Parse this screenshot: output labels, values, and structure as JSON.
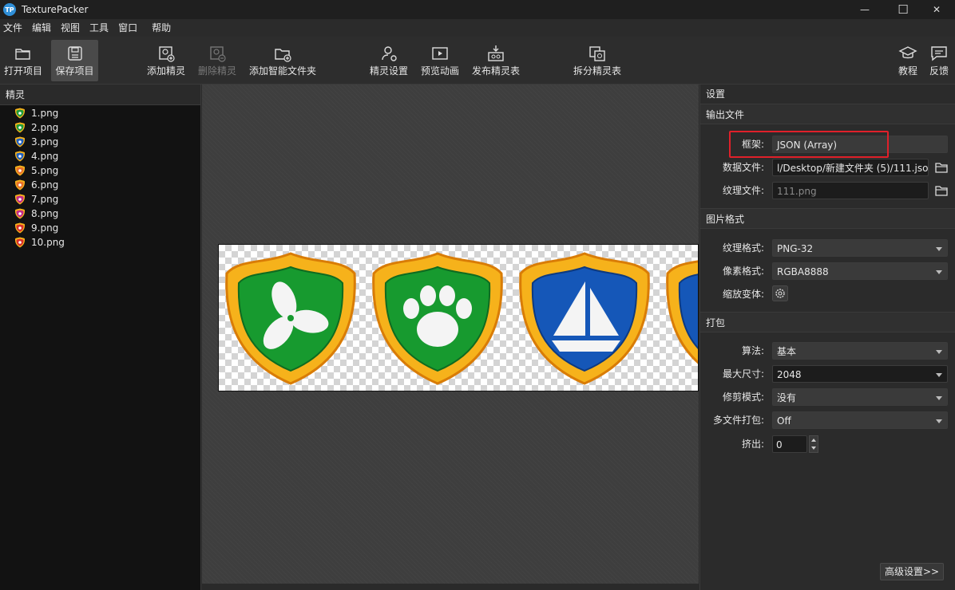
{
  "app": {
    "logo": "TP",
    "title": "TexturePacker"
  },
  "window_controls": [
    {
      "icon": "minimize-icon",
      "glyph": "—"
    },
    {
      "icon": "maximize-icon",
      "glyph": "☐"
    },
    {
      "icon": "close-icon",
      "glyph": "✕"
    }
  ],
  "menu": [
    "文件",
    "编辑",
    "视图",
    "工具",
    "窗口",
    "帮助"
  ],
  "toolbar": {
    "open_project": "打开项目",
    "save_project": "保存项目",
    "add_sprite": "添加精灵",
    "delete_sprite": "删除精灵",
    "add_smart_folder": "添加智能文件夹",
    "sprite_settings": "精灵设置",
    "preview_animation": "预览动画",
    "publish_sheet": "发布精灵表",
    "split_sheet": "拆分精灵表",
    "tutorial": "教程",
    "feedback": "反馈"
  },
  "sprites_panel": {
    "title": "精灵",
    "items": [
      {
        "name": "1.png",
        "color": "#1e9b3a"
      },
      {
        "name": "2.png",
        "color": "#1e9b3a"
      },
      {
        "name": "3.png",
        "color": "#1e5fc0"
      },
      {
        "name": "4.png",
        "color": "#1e5fc0"
      },
      {
        "name": "5.png",
        "color": "#e8702a"
      },
      {
        "name": "6.png",
        "color": "#e8702a"
      },
      {
        "name": "7.png",
        "color": "#c22a8a"
      },
      {
        "name": "8.png",
        "color": "#c22a8a"
      },
      {
        "name": "9.png",
        "color": "#d8302a"
      },
      {
        "name": "10.png",
        "color": "#d8302a"
      }
    ]
  },
  "settings": {
    "title": "设置",
    "output": {
      "title": "输出文件",
      "framework_label": "框架:",
      "framework_value": "JSON (Array)",
      "data_file_label": "数据文件:",
      "data_file_value": "l/Desktop/新建文件夹 (5)/111.json",
      "texture_file_label": "纹理文件:",
      "texture_file_value": "111.png"
    },
    "image_format": {
      "title": "图片格式",
      "texture_format_label": "纹理格式:",
      "texture_format_value": "PNG-32",
      "pixel_format_label": "像素格式:",
      "pixel_format_value": "RGBA8888",
      "scale_variants_label": "缩放变体:"
    },
    "packing": {
      "title": "打包",
      "algorithm_label": "算法:",
      "algorithm_value": "基本",
      "max_size_label": "最大尺寸:",
      "max_size_value": "2048",
      "trim_mode_label": "修剪模式:",
      "trim_mode_value": "没有",
      "multipack_label": "多文件打包:",
      "multipack_value": "Off",
      "extrude_label": "挤出:",
      "extrude_value": "0"
    },
    "advanced_button": "高级设置>>"
  },
  "colors": {
    "accent_highlight": "#e0202a",
    "badge_gold": "#f6b21b",
    "badge_green": "#179a2f",
    "badge_blue": "#1557b8"
  }
}
